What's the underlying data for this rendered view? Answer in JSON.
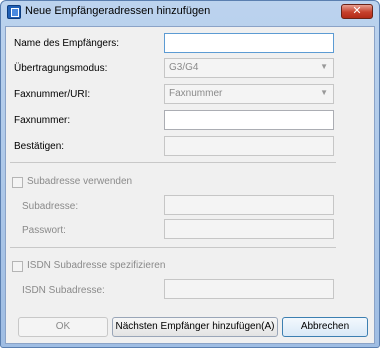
{
  "window": {
    "title": "Neue Empfängeradressen hinzufügen",
    "close_label": "✕"
  },
  "form": {
    "recipient_name_label": "Name des Empfängers:",
    "recipient_name_value": "",
    "transmission_mode_label": "Übertragungsmodus:",
    "transmission_mode_value": "G3/G4",
    "fax_uri_label": "Faxnummer/URI:",
    "fax_uri_value": "Faxnummer",
    "fax_number_label": "Faxnummer:",
    "fax_number_value": "",
    "confirm_label": "Bestätigen:",
    "confirm_value": ""
  },
  "subaddress": {
    "checkbox_label": "Subadresse verwenden",
    "checked": false,
    "subaddress_label": "Subadresse:",
    "password_label": "Passwort:"
  },
  "isdn": {
    "checkbox_label": "ISDN Subadresse spezifizieren",
    "checked": false,
    "subaddress_label": "ISDN Subadresse:"
  },
  "buttons": {
    "ok": "OK",
    "next_recipient": "Nächsten Empfänger hinzufügen(A)",
    "cancel": "Abbrechen"
  }
}
